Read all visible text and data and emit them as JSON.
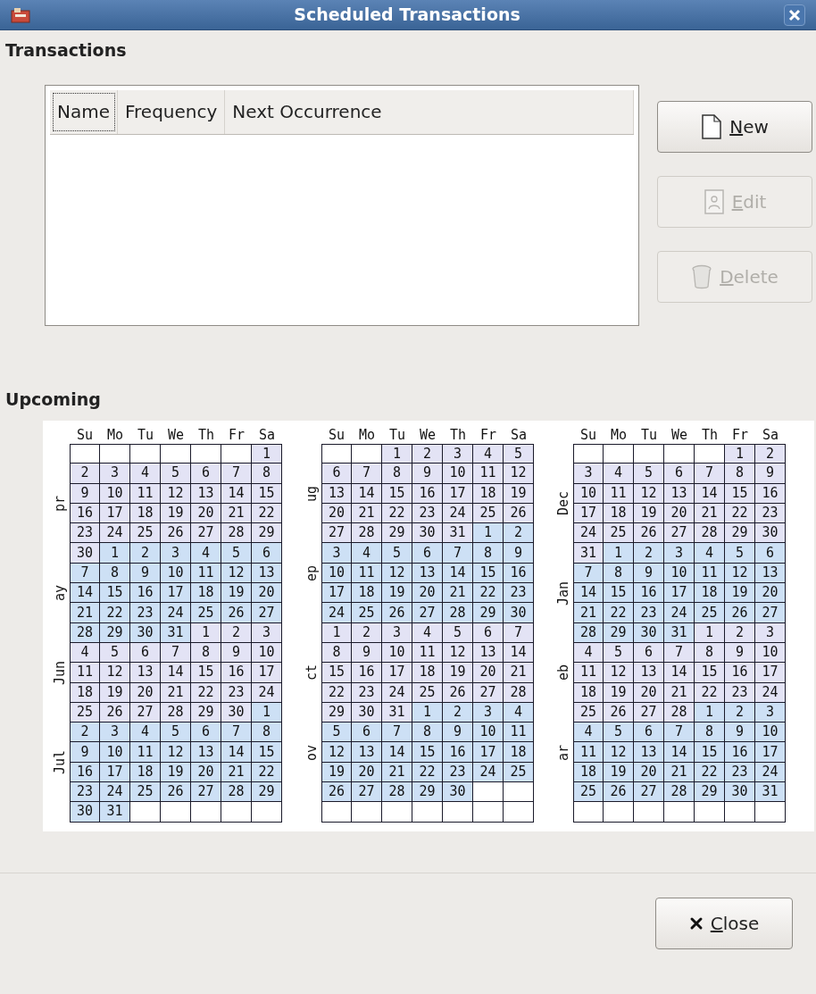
{
  "window": {
    "title": "Scheduled Transactions"
  },
  "transactions": {
    "heading": "Transactions",
    "columns": [
      {
        "label": "Name",
        "focused": true
      },
      {
        "label": "Frequency",
        "focused": false
      },
      {
        "label": "Next Occurrence",
        "focused": false
      }
    ],
    "buttons": [
      {
        "label": "New",
        "kind": "new",
        "disabled": false,
        "mnemonic": true
      },
      {
        "label": "Edit",
        "kind": "edit",
        "disabled": true,
        "mnemonic": true
      },
      {
        "label": "Delete",
        "kind": "delete",
        "disabled": true,
        "mnemonic": true
      }
    ]
  },
  "upcoming": {
    "heading": "Upcoming",
    "calendars": [
      {
        "weekdays": [
          "Su",
          "Mo",
          "Tu",
          "We",
          "Th",
          "Fr",
          "Sa"
        ],
        "months": [
          {
            "label": "pr",
            "color": "#e3e3f5",
            "before": [
              {
                "kind": "blank"
              },
              {
                "kind": "blank"
              },
              {
                "kind": "blank"
              },
              {
                "kind": "blank"
              },
              {
                "kind": "blank"
              },
              {
                "kind": "blank"
              }
            ],
            "days": [
              "1",
              "2",
              "3",
              "4",
              "5",
              "6",
              "7",
              "8",
              "9",
              "10",
              "11",
              "12",
              "13",
              "14",
              "15",
              "16",
              "17",
              "18",
              "19",
              "20",
              "21",
              "22",
              "23",
              "24",
              "25",
              "26",
              "27",
              "28",
              "29",
              "30"
            ]
          },
          {
            "label": "ay",
            "color": "#cde0f5",
            "days": [
              "1",
              "2",
              "3",
              "4",
              "5",
              "6",
              "7",
              "8",
              "9",
              "10",
              "11",
              "12",
              "13",
              "14",
              "15",
              "16",
              "17",
              "18",
              "19",
              "20",
              "21",
              "22",
              "23",
              "24",
              "25",
              "26",
              "27",
              "28",
              "29",
              "30",
              "31"
            ]
          },
          {
            "label": "Jun",
            "color": "#e3e3f5",
            "days": [
              "1",
              "2",
              "3",
              "4",
              "5",
              "6",
              "7",
              "8",
              "9",
              "10",
              "11",
              "12",
              "13",
              "14",
              "15",
              "16",
              "17",
              "18",
              "19",
              "20",
              "21",
              "22",
              "23",
              "24",
              "25",
              "26",
              "27",
              "28",
              "29",
              "30"
            ]
          },
          {
            "label": "Jul",
            "color": "#cde0f5",
            "days": [
              "1",
              "2",
              "3",
              "4",
              "5",
              "6",
              "7",
              "8",
              "9",
              "10",
              "11",
              "12",
              "13",
              "14",
              "15",
              "16",
              "17",
              "18",
              "19",
              "20",
              "21",
              "22",
              "23",
              "24",
              "25",
              "26",
              "27",
              "28",
              "29",
              "30",
              "31"
            ]
          }
        ]
      },
      {
        "weekdays": [
          "Su",
          "Mo",
          "Tu",
          "We",
          "Th",
          "Fr",
          "Sa"
        ],
        "months": [
          {
            "label": "ug",
            "color": "#e3e3f5",
            "before": [
              {
                "kind": "blank"
              },
              {
                "kind": "blank"
              }
            ],
            "days": [
              "1",
              "2",
              "3",
              "4",
              "5",
              "6",
              "7",
              "8",
              "9",
              "10",
              "11",
              "12",
              "13",
              "14",
              "15",
              "16",
              "17",
              "18",
              "19",
              "20",
              "21",
              "22",
              "23",
              "24",
              "25",
              "26",
              "27",
              "28",
              "29",
              "30",
              "31"
            ]
          },
          {
            "label": "ep",
            "color": "#cde0f5",
            "days": [
              "1",
              "2",
              "3",
              "4",
              "5",
              "6",
              "7",
              "8",
              "9",
              "10",
              "11",
              "12",
              "13",
              "14",
              "15",
              "16",
              "17",
              "18",
              "19",
              "20",
              "21",
              "22",
              "23",
              "24",
              "25",
              "26",
              "27",
              "28",
              "29",
              "30"
            ]
          },
          {
            "label": "ct",
            "color": "#e3e3f5",
            "days": [
              "1",
              "2",
              "3",
              "4",
              "5",
              "6",
              "7",
              "8",
              "9",
              "10",
              "11",
              "12",
              "13",
              "14",
              "15",
              "16",
              "17",
              "18",
              "19",
              "20",
              "21",
              "22",
              "23",
              "24",
              "25",
              "26",
              "27",
              "28",
              "29",
              "30",
              "31"
            ]
          },
          {
            "label": "ov",
            "color": "#cde0f5",
            "days": [
              "1",
              "2",
              "3",
              "4",
              "5",
              "6",
              "7",
              "8",
              "9",
              "10",
              "11",
              "12",
              "13",
              "14",
              "15",
              "16",
              "17",
              "18",
              "19",
              "20",
              "21",
              "22",
              "23",
              "24",
              "25",
              "26",
              "27",
              "28",
              "29",
              "30"
            ]
          }
        ]
      },
      {
        "weekdays": [
          "Su",
          "Mo",
          "Tu",
          "We",
          "Th",
          "Fr",
          "Sa"
        ],
        "months": [
          {
            "label": "Dec",
            "color": "#e3e3f5",
            "before": [
              {
                "kind": "blank"
              },
              {
                "kind": "blank"
              },
              {
                "kind": "blank"
              },
              {
                "kind": "blank"
              },
              {
                "kind": "blank"
              }
            ],
            "days": [
              "1",
              "2",
              "3",
              "4",
              "5",
              "6",
              "7",
              "8",
              "9",
              "10",
              "11",
              "12",
              "13",
              "14",
              "15",
              "16",
              "17",
              "18",
              "19",
              "20",
              "21",
              "22",
              "23",
              "24",
              "25",
              "26",
              "27",
              "28",
              "29",
              "30",
              "31"
            ]
          },
          {
            "label": "Jan",
            "color": "#cde0f5",
            "days": [
              "1",
              "2",
              "3",
              "4",
              "5",
              "6",
              "7",
              "8",
              "9",
              "10",
              "11",
              "12",
              "13",
              "14",
              "15",
              "16",
              "17",
              "18",
              "19",
              "20",
              "21",
              "22",
              "23",
              "24",
              "25",
              "26",
              "27",
              "28",
              "29",
              "30",
              "31"
            ]
          },
          {
            "label": "eb",
            "color": "#e3e3f5",
            "days": [
              "1",
              "2",
              "3",
              "4",
              "5",
              "6",
              "7",
              "8",
              "9",
              "10",
              "11",
              "12",
              "13",
              "14",
              "15",
              "16",
              "17",
              "18",
              "19",
              "20",
              "21",
              "22",
              "23",
              "24",
              "25",
              "26",
              "27",
              "28"
            ]
          },
          {
            "label": "ar",
            "color": "#cde0f5",
            "days": [
              "1",
              "2",
              "3",
              "4",
              "5",
              "6",
              "7",
              "8",
              "9",
              "10",
              "11",
              "12",
              "13",
              "14",
              "15",
              "16",
              "17",
              "18",
              "19",
              "20",
              "21",
              "22",
              "23",
              "24",
              "25",
              "26",
              "27",
              "28",
              "29",
              "30",
              "31"
            ]
          }
        ]
      }
    ]
  },
  "footer": {
    "buttons": [
      {
        "label": "Close",
        "kind": "close",
        "disabled": false,
        "mnemonic": true
      }
    ]
  }
}
